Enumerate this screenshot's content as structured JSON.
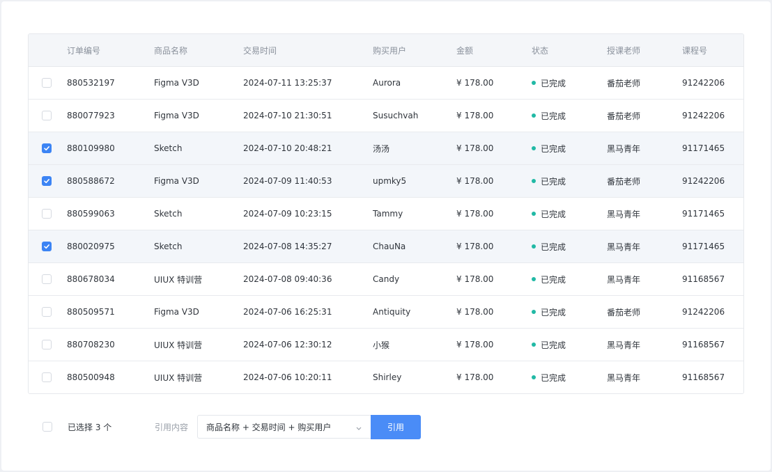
{
  "table": {
    "columns": [
      "订单编号",
      "商品名称",
      "交易时间",
      "购买用户",
      "金额",
      "状态",
      "授课老师",
      "课程号"
    ],
    "rows": [
      {
        "checked": false,
        "order": "880532197",
        "product": "Figma V3D",
        "time": "2024-07-11 13:25:37",
        "user": "Aurora",
        "amount": "¥ 178.00",
        "status": "已完成",
        "teacher": "番茄老师",
        "course": "91242206"
      },
      {
        "checked": false,
        "order": "880077923",
        "product": "Figma V3D",
        "time": "2024-07-10 21:30:51",
        "user": "Susuchvah",
        "amount": "¥ 178.00",
        "status": "已完成",
        "teacher": "番茄老师",
        "course": "91242206"
      },
      {
        "checked": true,
        "order": "880109980",
        "product": "Sketch",
        "time": "2024-07-10 20:48:21",
        "user": "汤汤",
        "amount": "¥ 178.00",
        "status": "已完成",
        "teacher": "黑马青年",
        "course": "91171465"
      },
      {
        "checked": true,
        "order": "880588672",
        "product": "Figma V3D",
        "time": "2024-07-09 11:40:53",
        "user": "upmky5",
        "amount": "¥ 178.00",
        "status": "已完成",
        "teacher": "番茄老师",
        "course": "91242206"
      },
      {
        "checked": false,
        "order": "880599063",
        "product": "Sketch",
        "time": "2024-07-09 10:23:15",
        "user": "Tammy",
        "amount": "¥ 178.00",
        "status": "已完成",
        "teacher": "黑马青年",
        "course": "91171465"
      },
      {
        "checked": true,
        "order": "880020975",
        "product": "Sketch",
        "time": "2024-07-08 14:35:27",
        "user": "ChauNa",
        "amount": "¥ 178.00",
        "status": "已完成",
        "teacher": "黑马青年",
        "course": "91171465"
      },
      {
        "checked": false,
        "order": "880678034",
        "product": "UIUX 特训营",
        "time": "2024-07-08 09:40:36",
        "user": "Candy",
        "amount": "¥ 178.00",
        "status": "已完成",
        "teacher": "黑马青年",
        "course": "91168567"
      },
      {
        "checked": false,
        "order": "880509571",
        "product": "Figma V3D",
        "time": "2024-07-06 16:25:31",
        "user": "Antiquity",
        "amount": "¥ 178.00",
        "status": "已完成",
        "teacher": "番茄老师",
        "course": "91242206"
      },
      {
        "checked": false,
        "order": "880708230",
        "product": "UIUX 特训营",
        "time": "2024-07-06 12:30:12",
        "user": "小猴",
        "amount": "¥ 178.00",
        "status": "已完成",
        "teacher": "黑马青年",
        "course": "91168567"
      },
      {
        "checked": false,
        "order": "880500948",
        "product": "UIUX 特训营",
        "time": "2024-07-06 10:20:11",
        "user": "Shirley",
        "amount": "¥ 178.00",
        "status": "已完成",
        "teacher": "黑马青年",
        "course": "91168567"
      }
    ]
  },
  "footer": {
    "selected_text": "已选择 3 个",
    "reference_label": "引用内容",
    "select_value": "商品名称 + 交易时间 + 购买用户",
    "button_label": "引用"
  },
  "colors": {
    "accent": "#4a8cf7",
    "status_done": "#21b9a5",
    "selected_row": "#f3f6fa",
    "header_bg": "#f4f6f9"
  },
  "icons": {
    "check": "check-icon",
    "status": "status-dot-icon",
    "dropdown": "chevron-down-icon"
  }
}
